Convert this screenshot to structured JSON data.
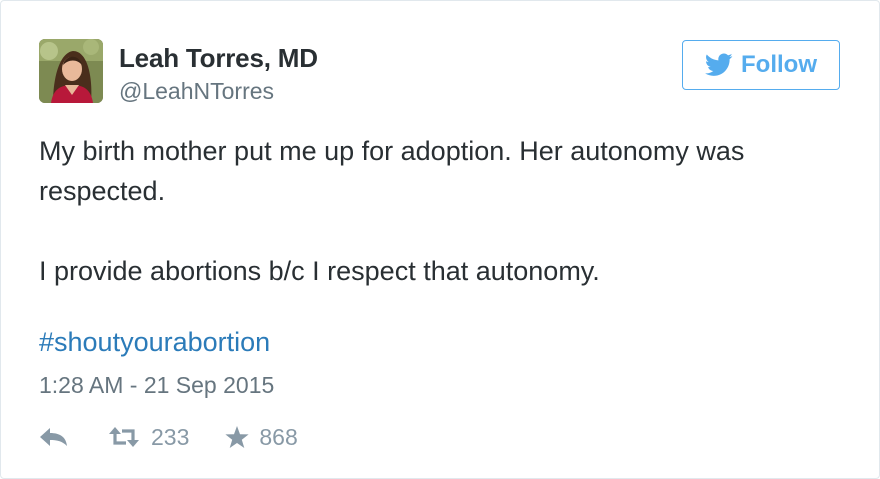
{
  "author": {
    "name": "Leah Torres, MD",
    "handle": "@LeahNTorres"
  },
  "follow_button": {
    "label": "Follow",
    "icon": "twitter-bird-icon",
    "color": "#55acee"
  },
  "tweet": {
    "lines": [
      "My birth mother put me up for adoption. Her autonomy was",
      "respected.",
      "I provide abortions b/c I respect that autonomy."
    ],
    "hashtag": "#shoutyourabortion",
    "timestamp": "1:28 AM - 21 Sep 2015"
  },
  "actions": {
    "reply": {
      "icon": "reply-icon"
    },
    "retweet": {
      "icon": "retweet-icon",
      "count": "233"
    },
    "favorite": {
      "icon": "star-icon",
      "count": "868"
    }
  },
  "colors": {
    "text": "#292f33",
    "secondary": "#66757f",
    "link": "#2b7bb9",
    "action": "#8899a6",
    "border": "#e1e8ed"
  }
}
